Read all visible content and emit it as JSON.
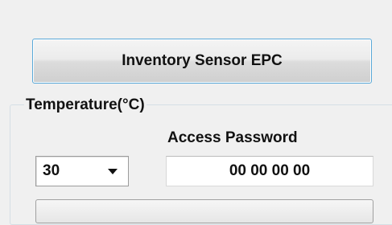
{
  "buttons": {
    "inventory_sensor_epc": "Inventory Sensor EPC"
  },
  "temperature_group": {
    "legend": "Temperature(°C)",
    "selected_value": "30",
    "access_password_label": "Access Password",
    "access_password_value": "00 00 00 00"
  },
  "icons": {
    "dropdown": "chevron-down-icon"
  }
}
